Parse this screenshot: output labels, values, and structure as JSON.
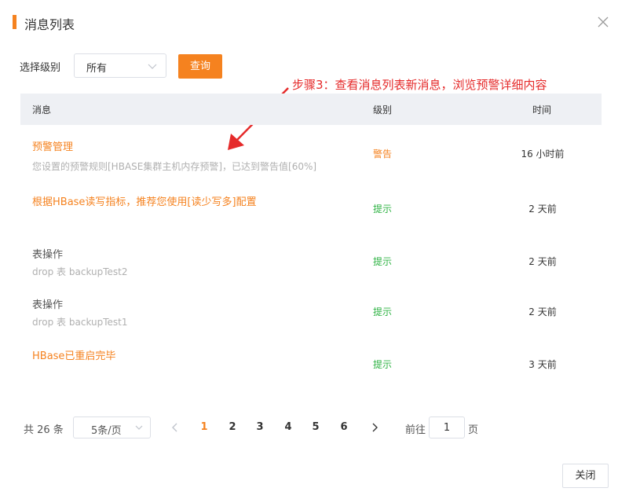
{
  "dialog": {
    "title": "消息列表",
    "close_icon": "close-icon",
    "accent": "#f5821f"
  },
  "filter": {
    "label": "选择级别",
    "selected": "所有",
    "query_button": "查询"
  },
  "annotation": {
    "text": "步骤3：查看消息列表新消息，浏览预警详细内容",
    "color": "#e52a2a"
  },
  "table": {
    "headers": {
      "message": "消息",
      "level": "级别",
      "time": "时间"
    },
    "rows": [
      {
        "title": "预警管理",
        "subtitle": "您设置的预警规则[HBASE集群主机内存预警]，已达到警告值[60%]",
        "level": "警告",
        "time": "16 小时前",
        "title_color": "#f5821f",
        "level_color": "#f5821f"
      },
      {
        "title": "根据HBase读写指标，推荐您使用[读少写多]配置",
        "subtitle": "",
        "level": "提示",
        "time": "2 天前",
        "title_color": "#f5821f",
        "level_color": "#2fb344"
      },
      {
        "title": "表操作",
        "subtitle": "drop 表 backupTest2",
        "level": "提示",
        "time": "2 天前",
        "title_color": "#555555",
        "level_color": "#2fb344"
      },
      {
        "title": "表操作",
        "subtitle": "drop 表 backupTest1",
        "level": "提示",
        "time": "2 天前",
        "title_color": "#555555",
        "level_color": "#2fb344"
      },
      {
        "title": "HBase已重启完毕",
        "subtitle": "",
        "level": "提示",
        "time": "3 天前",
        "title_color": "#f5821f",
        "level_color": "#2fb344"
      }
    ]
  },
  "pagination": {
    "total": "共 26 条",
    "page_size": "5条/页",
    "pages": [
      "1",
      "2",
      "3",
      "4",
      "5",
      "6"
    ],
    "current_page": "1",
    "goto_label": "前往",
    "goto_value": "1",
    "goto_suffix": "页"
  },
  "footer": {
    "close_button": "关闭"
  }
}
